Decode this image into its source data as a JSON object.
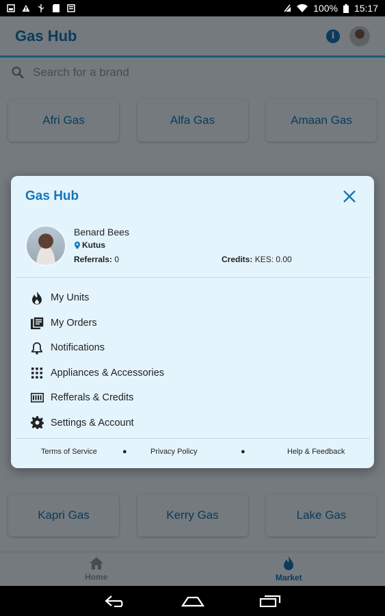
{
  "status_bar": {
    "battery": "100%",
    "time": "15:17"
  },
  "app_bar": {
    "title": "Gas Hub",
    "info_icon": "info-icon",
    "avatar": "profile-avatar"
  },
  "search": {
    "placeholder": "Search for a brand"
  },
  "brands_top": [
    "Afri Gas",
    "Alfa Gas",
    "Amaan Gas"
  ],
  "brands_bottom": [
    "Kapri Gas",
    "Kerry Gas",
    "Lake Gas"
  ],
  "bottom_nav": {
    "items": [
      {
        "label": "Home",
        "icon": "home-icon",
        "active": false
      },
      {
        "label": "Market",
        "icon": "flame-icon",
        "active": true
      }
    ]
  },
  "dialog": {
    "title": "Gas Hub",
    "profile": {
      "name": "Benard Bees",
      "location": "Kutus",
      "referrals_label": "Referrals:",
      "referrals_value": "0",
      "credits_label": "Credits:",
      "credits_value": "KES: 0.00"
    },
    "menu": [
      {
        "label": "My Units",
        "icon": "flame-icon"
      },
      {
        "label": "My Orders",
        "icon": "orders-icon"
      },
      {
        "label": "Notifications",
        "icon": "bell-icon"
      },
      {
        "label": "Appliances & Accessories",
        "icon": "grid-icon"
      },
      {
        "label": "Refferals & Credits",
        "icon": "credits-icon"
      },
      {
        "label": "Settings & Account",
        "icon": "gear-icon"
      }
    ],
    "footer": {
      "terms": "Terms of Service",
      "privacy": "Privacy Policy",
      "help": "Help & Feedback"
    }
  },
  "colors": {
    "primary": "#1476b8",
    "accent_line": "#3bb0e8",
    "background": "#e9f5fc",
    "dialog_bg": "#e4f4fd"
  }
}
